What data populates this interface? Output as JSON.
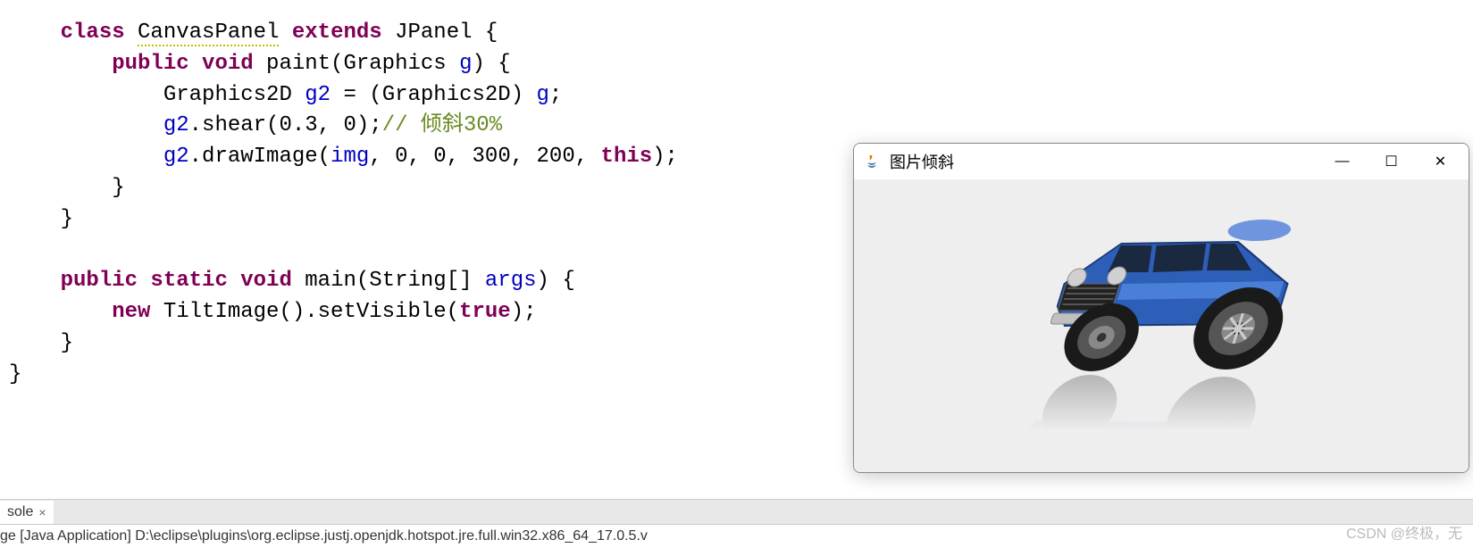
{
  "code": {
    "tokens": [
      {
        "indent": 1,
        "parts": [
          {
            "t": "class ",
            "c": "kw"
          },
          {
            "t": "CanvasPanel",
            "c": "cls cls-underline"
          },
          {
            "t": " ",
            "c": ""
          },
          {
            "t": "extends ",
            "c": "kw"
          },
          {
            "t": "JPanel {",
            "c": "cls"
          }
        ]
      },
      {
        "indent": 2,
        "parts": [
          {
            "t": "public void ",
            "c": "kw"
          },
          {
            "t": "paint(Graphics ",
            "c": "method"
          },
          {
            "t": "g",
            "c": "field"
          },
          {
            "t": ") {",
            "c": ""
          }
        ]
      },
      {
        "indent": 3,
        "parts": [
          {
            "t": "Graphics2D ",
            "c": ""
          },
          {
            "t": "g2",
            "c": "field"
          },
          {
            "t": " = (Graphics2D) ",
            "c": ""
          },
          {
            "t": "g",
            "c": "field"
          },
          {
            "t": ";",
            "c": ""
          }
        ]
      },
      {
        "indent": 3,
        "parts": [
          {
            "t": "g2",
            "c": "field"
          },
          {
            "t": ".shear(0.3, 0);",
            "c": ""
          },
          {
            "t": "// 倾斜30%",
            "c": "comment"
          }
        ]
      },
      {
        "indent": 3,
        "parts": [
          {
            "t": "g2",
            "c": "field"
          },
          {
            "t": ".drawImage(",
            "c": ""
          },
          {
            "t": "img",
            "c": "field"
          },
          {
            "t": ", 0, 0, 300, 200, ",
            "c": ""
          },
          {
            "t": "this",
            "c": "kw"
          },
          {
            "t": ");",
            "c": ""
          }
        ]
      },
      {
        "indent": 2,
        "parts": [
          {
            "t": "}",
            "c": ""
          }
        ]
      },
      {
        "indent": 1,
        "parts": [
          {
            "t": "}",
            "c": ""
          }
        ]
      },
      {
        "indent": 0,
        "parts": [
          {
            "t": "",
            "c": ""
          }
        ]
      },
      {
        "indent": 1,
        "parts": [
          {
            "t": "public static void ",
            "c": "kw"
          },
          {
            "t": "main(String[] ",
            "c": "method"
          },
          {
            "t": "args",
            "c": "field"
          },
          {
            "t": ") {",
            "c": ""
          }
        ]
      },
      {
        "indent": 2,
        "parts": [
          {
            "t": "new ",
            "c": "kw"
          },
          {
            "t": "TiltImage().setVisible(",
            "c": ""
          },
          {
            "t": "true",
            "c": "bool"
          },
          {
            "t": ");",
            "c": ""
          }
        ]
      },
      {
        "indent": 1,
        "parts": [
          {
            "t": "}",
            "c": ""
          }
        ]
      },
      {
        "indent": 0,
        "parts": [
          {
            "t": "}",
            "c": ""
          }
        ]
      }
    ]
  },
  "console": {
    "tab_label": "sole",
    "close_glyph": "×",
    "line": "ge [Java Application] D:\\eclipse\\plugins\\org.eclipse.justj.openjdk.hotspot.jre.full.win32.x86_64_17.0.5.v"
  },
  "window": {
    "title": "图片倾斜",
    "minimize_glyph": "—",
    "maximize_glyph": "☐",
    "close_glyph": "✕"
  },
  "watermark": "CSDN @终极，无"
}
